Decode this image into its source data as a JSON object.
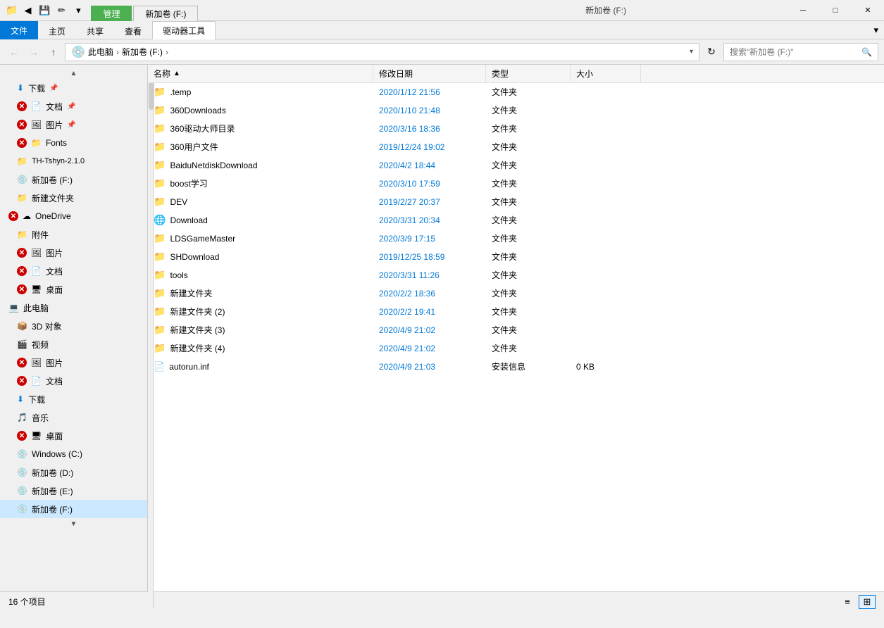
{
  "titlebar": {
    "quick_access": [
      "⬅",
      "💾",
      "📁"
    ],
    "tabs": [
      {
        "id": "management",
        "label": "管理",
        "active": true
      },
      {
        "id": "drive",
        "label": "新加卷 (F:)",
        "active": false
      }
    ],
    "window_title": "新加卷 (F:)",
    "controls": {
      "minimize": "─",
      "maximize": "□",
      "close": "✕"
    }
  },
  "ribbon": {
    "tabs": [
      {
        "id": "file",
        "label": "文件",
        "type": "file"
      },
      {
        "id": "home",
        "label": "主页"
      },
      {
        "id": "share",
        "label": "共享"
      },
      {
        "id": "view",
        "label": "查看"
      },
      {
        "id": "driver-tools",
        "label": "驱动器工具",
        "active": true
      }
    ],
    "expand_icon": "▾"
  },
  "addressbar": {
    "back": "←",
    "forward": "→",
    "up": "↑",
    "drive_icon": "💿",
    "path": [
      "此电脑",
      "新加卷 (F:)"
    ],
    "refresh": "↻",
    "search_placeholder": "搜索\"新加卷 (F:)\"",
    "search_icon": "🔍"
  },
  "sidebar": {
    "scroll_up": "▲",
    "items": [
      {
        "id": "downloads",
        "label": "下载",
        "icon": "⬇",
        "indent": 1,
        "pinned": true,
        "error": false
      },
      {
        "id": "documents",
        "label": "文档",
        "icon": "📄",
        "indent": 1,
        "pinned": true,
        "error": true
      },
      {
        "id": "pictures",
        "label": "图片",
        "icon": "🖼",
        "indent": 1,
        "pinned": true,
        "error": true
      },
      {
        "id": "fonts",
        "label": "Fonts",
        "icon": "📁",
        "indent": 1,
        "error": true
      },
      {
        "id": "th-tshyn",
        "label": "TH-Tshyn-2.1.0",
        "icon": "📁",
        "indent": 1,
        "error": false
      },
      {
        "id": "xinjiajuan-f",
        "label": "新加卷 (F:)",
        "icon": "💿",
        "indent": 1,
        "error": false
      },
      {
        "id": "new-folder-quick",
        "label": "新建文件夹",
        "icon": "📁",
        "indent": 1,
        "error": false
      },
      {
        "id": "onedrive",
        "label": "OneDrive",
        "icon": "☁",
        "indent": 0,
        "error": true
      },
      {
        "id": "attachments",
        "label": "附件",
        "icon": "📎",
        "indent": 1,
        "error": false
      },
      {
        "id": "pictures2",
        "label": "图片",
        "icon": "🖼",
        "indent": 1,
        "error": true
      },
      {
        "id": "documents2",
        "label": "文档",
        "icon": "📄",
        "indent": 1,
        "error": true
      },
      {
        "id": "desktop",
        "label": "桌面",
        "icon": "🖥",
        "indent": 1,
        "error": true
      },
      {
        "id": "this-pc",
        "label": "此电脑",
        "icon": "💻",
        "indent": 0,
        "error": false
      },
      {
        "id": "3d-objects",
        "label": "3D 对象",
        "icon": "📦",
        "indent": 1,
        "error": false
      },
      {
        "id": "videos",
        "label": "视频",
        "icon": "🎬",
        "indent": 1,
        "error": false
      },
      {
        "id": "pictures3",
        "label": "图片",
        "icon": "🖼",
        "indent": 1,
        "error": true
      },
      {
        "id": "documents3",
        "label": "文档",
        "icon": "📄",
        "indent": 1,
        "error": true
      },
      {
        "id": "downloads2",
        "label": "下载",
        "icon": "⬇",
        "indent": 1,
        "error": false
      },
      {
        "id": "music",
        "label": "音乐",
        "icon": "🎵",
        "indent": 1,
        "error": false
      },
      {
        "id": "desktop2",
        "label": "桌面",
        "icon": "🖥",
        "indent": 1,
        "error": true
      },
      {
        "id": "windows-c",
        "label": "Windows (C:)",
        "icon": "💿",
        "indent": 1,
        "error": false
      },
      {
        "id": "xinjia-d",
        "label": "新加卷 (D:)",
        "icon": "💿",
        "indent": 1,
        "error": false
      },
      {
        "id": "xinjia-e",
        "label": "新加卷 (E:)",
        "icon": "💿",
        "indent": 1,
        "error": false
      },
      {
        "id": "xinjia-f",
        "label": "新加卷 (F:)",
        "icon": "💿",
        "indent": 1,
        "error": false,
        "selected": true
      }
    ],
    "scroll_down": "▼"
  },
  "file_list": {
    "headers": [
      {
        "id": "name",
        "label": "名称",
        "sort": "asc"
      },
      {
        "id": "date",
        "label": "修改日期"
      },
      {
        "id": "type",
        "label": "类型"
      },
      {
        "id": "size",
        "label": "大小"
      }
    ],
    "files": [
      {
        "name": ".temp",
        "date": "2020/1/12 21:56",
        "type": "文件夹",
        "size": "",
        "icon": "folder",
        "web": false
      },
      {
        "name": "360Downloads",
        "date": "2020/1/10 21:48",
        "type": "文件夹",
        "size": "",
        "icon": "folder",
        "web": false
      },
      {
        "name": "360驱动大师目录",
        "date": "2020/3/16 18:36",
        "type": "文件夹",
        "size": "",
        "icon": "folder",
        "web": false
      },
      {
        "name": "360用户文件",
        "date": "2019/12/24 19:02",
        "type": "文件夹",
        "size": "",
        "icon": "folder",
        "web": false
      },
      {
        "name": "BaiduNetdiskDownload",
        "date": "2020/4/2 18:44",
        "type": "文件夹",
        "size": "",
        "icon": "folder",
        "web": false
      },
      {
        "name": "boost学习",
        "date": "2020/3/10 17:59",
        "type": "文件夹",
        "size": "",
        "icon": "folder",
        "web": false
      },
      {
        "name": "DEV",
        "date": "2019/2/27 20:37",
        "type": "文件夹",
        "size": "",
        "icon": "folder",
        "web": false
      },
      {
        "name": "Download",
        "date": "2020/3/31 20:34",
        "type": "文件夹",
        "size": "",
        "icon": "web",
        "web": true
      },
      {
        "name": "LDSGameMaster",
        "date": "2020/3/9 17:15",
        "type": "文件夹",
        "size": "",
        "icon": "folder",
        "web": false
      },
      {
        "name": "SHDownload",
        "date": "2019/12/25 18:59",
        "type": "文件夹",
        "size": "",
        "icon": "folder",
        "web": false
      },
      {
        "name": "tools",
        "date": "2020/3/31 11:26",
        "type": "文件夹",
        "size": "",
        "icon": "folder",
        "web": false
      },
      {
        "name": "新建文件夹",
        "date": "2020/2/2 18:36",
        "type": "文件夹",
        "size": "",
        "icon": "folder",
        "web": false
      },
      {
        "name": "新建文件夹 (2)",
        "date": "2020/2/2 19:41",
        "type": "文件夹",
        "size": "",
        "icon": "folder",
        "web": false
      },
      {
        "name": "新建文件夹 (3)",
        "date": "2020/4/9 21:02",
        "type": "文件夹",
        "size": "",
        "icon": "folder",
        "web": false
      },
      {
        "name": "新建文件夹 (4)",
        "date": "2020/4/9 21:02",
        "type": "文件夹",
        "size": "",
        "icon": "folder",
        "web": false
      },
      {
        "name": "autorun.inf",
        "date": "2020/4/9 21:03",
        "type": "安装信息",
        "size": "0 KB",
        "icon": "inf",
        "web": false
      }
    ]
  },
  "statusbar": {
    "count_text": "16 个项目",
    "view_list": "≡",
    "view_details": "⊞"
  }
}
